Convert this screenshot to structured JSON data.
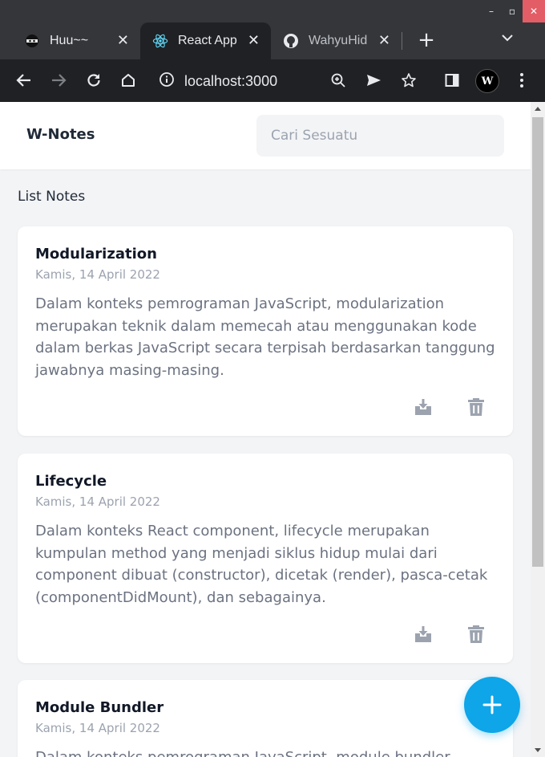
{
  "browser": {
    "tabs": [
      {
        "title": "Huu~~",
        "favicon": "ninja-icon"
      },
      {
        "title": "React App",
        "favicon": "react-icon",
        "active": true
      },
      {
        "title": "WahyuHid",
        "favicon": "github-icon"
      }
    ],
    "url": "localhost:3000",
    "avatar_text": "W"
  },
  "header": {
    "brand": "W-Notes",
    "search_placeholder": "Cari Sesuatu"
  },
  "main": {
    "section_title": "List Notes",
    "notes": [
      {
        "title": "Modularization",
        "date": "Kamis, 14 April 2022",
        "body": "Dalam konteks pemrograman JavaScript, modularization merupakan teknik dalam memecah atau menggunakan kode dalam berkas JavaScript secara terpisah berdasarkan tanggung jawabnya masing-masing."
      },
      {
        "title": "Lifecycle",
        "date": "Kamis, 14 April 2022",
        "body": "Dalam konteks React component, lifecycle merupakan kumpulan method yang menjadi siklus hidup mulai dari component dibuat (constructor), dicetak (render), pasca-cetak (componentDidMount), dan sebagainya."
      },
      {
        "title": "Module Bundler",
        "date": "Kamis, 14 April 2022",
        "body": "Dalam konteks pemrograman JavaScript, module bundler"
      }
    ]
  },
  "colors": {
    "accent": "#0ea5e9",
    "chrome_dark": "#202124",
    "page_bg": "#f3f4f6"
  }
}
